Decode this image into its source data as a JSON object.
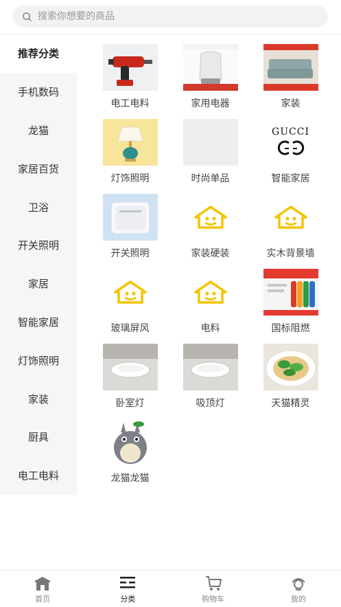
{
  "search": {
    "placeholder": "搜索你想要的商品"
  },
  "sidebar": {
    "items": [
      {
        "label": "推荐分类",
        "active": true
      },
      {
        "label": "手机数码"
      },
      {
        "label": "龙猫"
      },
      {
        "label": "家居百货"
      },
      {
        "label": "卫浴"
      },
      {
        "label": "开关照明"
      },
      {
        "label": "家居"
      },
      {
        "label": "智能家居"
      },
      {
        "label": "灯饰照明"
      },
      {
        "label": "家装"
      },
      {
        "label": "厨具"
      },
      {
        "label": "电工电料"
      }
    ]
  },
  "grid": {
    "items": [
      {
        "label": "电工电料",
        "icon": "drill-image"
      },
      {
        "label": "家用电器",
        "icon": "humidifier-image"
      },
      {
        "label": "家装",
        "icon": "sofa-image"
      },
      {
        "label": "灯饰照明",
        "icon": "table-lamp-image"
      },
      {
        "label": "时尚单品",
        "icon": "blank-image"
      },
      {
        "label": "智能家居",
        "icon": "gucci-logo",
        "logo_text": "GUCCI"
      },
      {
        "label": "开关照明",
        "icon": "wall-switch-image"
      },
      {
        "label": "家装硬装",
        "icon": "house-placeholder-icon"
      },
      {
        "label": "实木背景墙",
        "icon": "house-placeholder-icon"
      },
      {
        "label": "玻璃屏风",
        "icon": "house-placeholder-icon"
      },
      {
        "label": "电料",
        "icon": "house-placeholder-icon"
      },
      {
        "label": "国标阻燃",
        "icon": "cable-rolls-image"
      },
      {
        "label": "卧室灯",
        "icon": "ceiling-light-image"
      },
      {
        "label": "吸顶灯",
        "icon": "ceiling-light-image"
      },
      {
        "label": "天猫精灵",
        "icon": "food-bowl-image"
      },
      {
        "label": "龙猫龙猫",
        "icon": "totoro-image"
      }
    ]
  },
  "tabbar": {
    "items": [
      {
        "label": "首页",
        "icon": "home-icon"
      },
      {
        "label": "分类",
        "icon": "category-icon",
        "active": true
      },
      {
        "label": "购物车",
        "icon": "cart-icon"
      },
      {
        "label": "我的",
        "icon": "profile-icon"
      }
    ]
  },
  "colors": {
    "accent": "#f5c400",
    "sidebar_bg": "#f6f6f6",
    "text": "#333333"
  }
}
